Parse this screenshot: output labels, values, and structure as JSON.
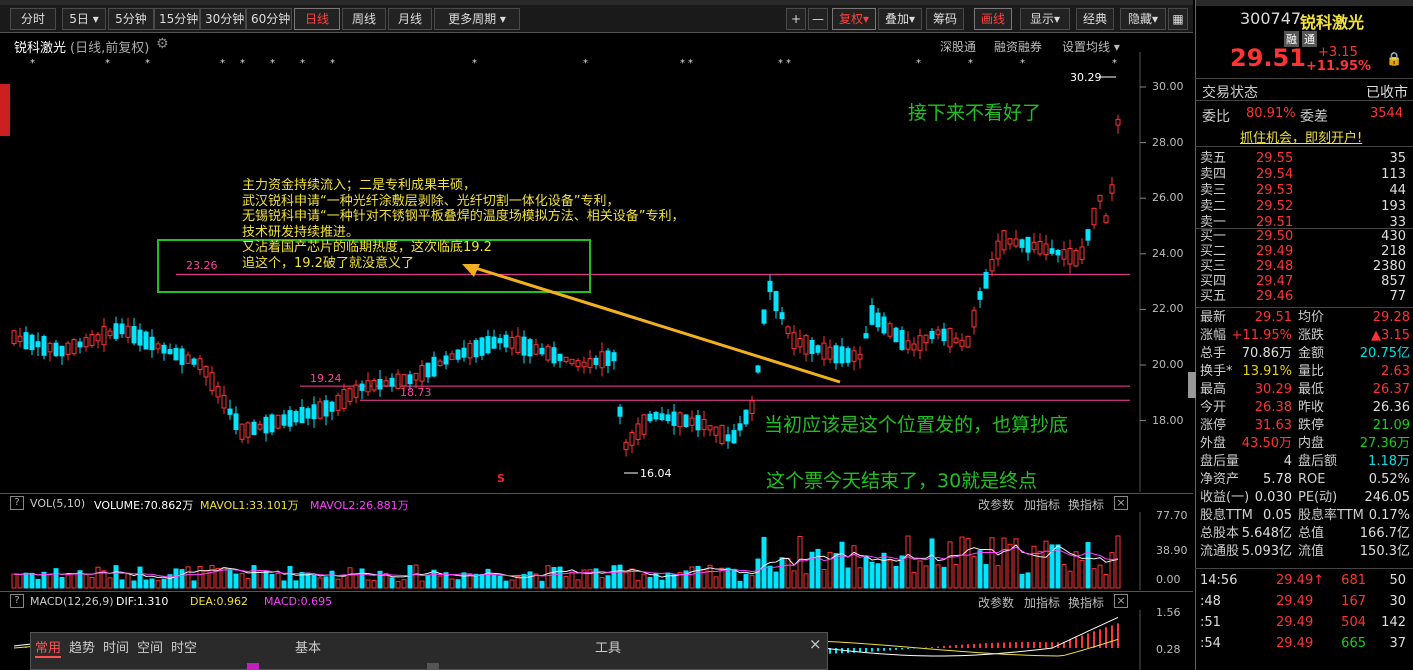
{
  "toolbar": {
    "top": [
      "分时",
      "5日",
      "5分钟",
      "15分钟",
      "30分钟",
      "60分钟",
      "日线",
      "周线",
      "月线",
      "更多周期"
    ],
    "active": "日线",
    "right": [
      "+",
      "—",
      "复权",
      "叠加",
      "筹码",
      "画线",
      "显示",
      "经典",
      "隐藏"
    ]
  },
  "chart": {
    "stock_title": "锐科激光",
    "sub": "(日线,前复权)",
    "links": [
      "深股通",
      "融资融券",
      "设置均线"
    ],
    "y_ticks": [
      "30.00",
      "28.00",
      "26.00",
      "24.00",
      "22.00",
      "20.00",
      "18.00"
    ],
    "high_label": "30.29",
    "low_label": "16.04",
    "line_labels": [
      "23.26",
      "19.24",
      "18.73"
    ],
    "s_marker": "S",
    "annotation": [
      "主力资金持续流入；二是专利成果丰硕，",
      "武汉锐科申请“一种光纤涂敷层剥除、光纤切割一体化设备”专利，",
      "无锡锐科申请“一种针对不锈钢平板叠焊的温度场模拟方法、相关设备”专利，",
      "技术研发持续推进。",
      "又沾着国产芯片的临期热度，这次临底19.2",
      "追这个，19.2破了就没意义了"
    ],
    "green_notes": [
      "接下来不看好了",
      "当初应该是这个位置发的，也算抄底",
      "这个票今天结束了，30就是终点"
    ]
  },
  "volume": {
    "legend": "VOL(5,10)",
    "vol": "VOLUME:70.862万",
    "m1": "MAVOL1:33.101万",
    "m2": "MAVOL2:26.881万",
    "y_ticks": [
      "77.70",
      "38.90",
      "0.00"
    ],
    "tools": [
      "改参数",
      "加指标",
      "换指标"
    ]
  },
  "macd": {
    "legend": "MACD(12,26,9)",
    "dif": "DIF:1.310",
    "dea": "DEA:0.962",
    "macd": "MACD:0.695",
    "y_ticks": [
      "1.56",
      "0.28"
    ],
    "tools": [
      "改参数",
      "加指标",
      "换指标"
    ]
  },
  "bottom_panel": {
    "tabs": [
      "常用",
      "趋势",
      "时间",
      "空间",
      "时空"
    ],
    "sections": [
      "基本",
      "工具"
    ],
    "close": "×"
  },
  "quote": {
    "code": "300747",
    "name": "锐科激光",
    "tags": [
      "融",
      "通"
    ],
    "price": "29.51",
    "chg": "+3.15",
    "pct": "+11.95%",
    "state_label": "交易状态",
    "state": "已收市",
    "weibi_l": "委比",
    "weibi": "80.91%",
    "weicha_l": "委差",
    "weicha": "3544",
    "promo": "抓住机会，即刻开户!",
    "asks": [
      [
        "卖五",
        "29.55",
        "35"
      ],
      [
        "卖四",
        "29.54",
        "113"
      ],
      [
        "卖三",
        "29.53",
        "44"
      ],
      [
        "卖二",
        "29.52",
        "193"
      ],
      [
        "卖一",
        "29.51",
        "33"
      ]
    ],
    "bids": [
      [
        "买一",
        "29.50",
        "430"
      ],
      [
        "买二",
        "29.49",
        "218"
      ],
      [
        "买三",
        "29.48",
        "2380"
      ],
      [
        "买四",
        "29.47",
        "857"
      ],
      [
        "买五",
        "29.46",
        "77"
      ]
    ],
    "stats": [
      [
        "最新",
        "29.51",
        "r",
        "均价",
        "29.28",
        "r"
      ],
      [
        "涨幅",
        "+11.95%",
        "r",
        "涨跌",
        "▲3.15",
        "r"
      ],
      [
        "总手",
        "70.86万",
        "w",
        "金额",
        "20.75亿",
        "c"
      ],
      [
        "换手*",
        "13.91%",
        "y",
        "量比",
        "2.63",
        "r"
      ],
      [
        "最高",
        "30.29",
        "r",
        "最低",
        "26.37",
        "r"
      ],
      [
        "今开",
        "26.38",
        "r",
        "昨收",
        "26.36",
        "w"
      ],
      [
        "涨停",
        "31.63",
        "r",
        "跌停",
        "21.09",
        "g"
      ],
      [
        "外盘",
        "43.50万",
        "r",
        "内盘",
        "27.36万",
        "g"
      ],
      [
        "盘后量",
        "4",
        "w",
        "盘后额",
        "1.18万",
        "c"
      ],
      [
        "净资产",
        "5.78",
        "w",
        "ROE",
        "0.52%",
        "w"
      ],
      [
        "收益(一)",
        "0.030",
        "w",
        "PE(动)",
        "246.05",
        "w"
      ],
      [
        "股息TTM",
        "0.05",
        "w",
        "股息率TTM",
        "0.17%",
        "w"
      ],
      [
        "总股本",
        "5.648亿",
        "w",
        "总值",
        "166.7亿",
        "w"
      ],
      [
        "流通股",
        "5.093亿",
        "w",
        "流值",
        "150.3亿",
        "w"
      ]
    ],
    "ticks": [
      [
        "14:56",
        "29.49↑",
        "681",
        "50"
      ],
      [
        ":48",
        "29.49",
        "167",
        "30"
      ],
      [
        ":51",
        "29.49",
        "504",
        "142"
      ],
      [
        ":54",
        "29.49",
        "665",
        "37"
      ]
    ]
  }
}
